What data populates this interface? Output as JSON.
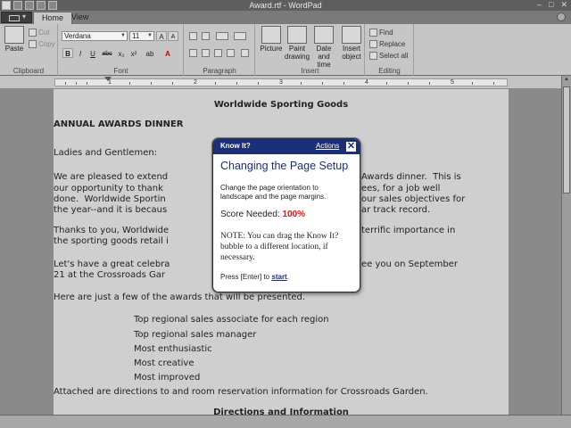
{
  "window": {
    "title": "Award.rtf - WordPad",
    "controls": {
      "minimize": "–",
      "maximize": "□",
      "close": "✕"
    }
  },
  "tabs": [
    {
      "label": "Home"
    },
    {
      "label": "View"
    }
  ],
  "ribbon": {
    "clipboard": {
      "label": "Clipboard",
      "paste": "Paste",
      "cut": "Cut",
      "copy": "Copy"
    },
    "font": {
      "label": "Font",
      "family": "Verdana",
      "size": "11",
      "grow": "A",
      "shrink": "A",
      "bold": "B",
      "italic": "I",
      "underline": "U",
      "strike": "abc",
      "subscript": "x₂",
      "superscript": "x²",
      "highlight": "ab",
      "color": "A"
    },
    "paragraph": {
      "label": "Paragraph"
    },
    "insert": {
      "label": "Insert",
      "picture": "Picture",
      "paint": "Paint drawing",
      "datetime": "Date and time",
      "object": "Insert object"
    },
    "editing": {
      "label": "Editing",
      "find": "Find",
      "replace": "Replace",
      "select_all": "Select all"
    }
  },
  "ruler": {
    "numbers": [
      "1",
      "2",
      "3",
      "4",
      "5"
    ]
  },
  "document": {
    "company": "Worldwide Sporting Goods",
    "heading": "ANNUAL AWARDS DINNER",
    "greeting": "Ladies and Gentlemen:",
    "para1": [
      "We are pleased to extend",
      "our opportunity to thank",
      "done.  Worldwide Sportin",
      "the year--and it is becaus"
    ],
    "para1_right": [
      "Awards dinner.  This is",
      "ees, for a job well",
      "our sales objectives for",
      "ar track record."
    ],
    "para2": [
      "Thanks to you, Worldwide",
      "the sporting goods retail i"
    ],
    "para2_right": [
      "terrific importance in"
    ],
    "para3": [
      "Let's have a great celebra",
      "21 at the Crossroads Gar"
    ],
    "para3_right": [
      "ee you on September"
    ],
    "awards_intro": "Here are just a few of the awards that will be presented.",
    "awards": [
      "Top regional sales associate for each region",
      "Top regional sales manager",
      "Most enthusiastic",
      "Most creative",
      "Most improved"
    ],
    "attached": "Attached are directions to and room reservation information for Crossroads Garden.",
    "section2": "Directions and Information"
  },
  "bubble": {
    "title": "Know It?",
    "actions": "Actions",
    "close": "✕",
    "heading": "Changing the Page Setup",
    "description_line1": "Change the page orientation to",
    "description_line2": "landscape and the page margins.",
    "score_label": "Score Needed:",
    "score_value": "100%",
    "note": "NOTE: You can drag the Know It? bubble to a different location, if necessary.",
    "press_prefix": "Press [Enter] to",
    "start_link": "start",
    "press_suffix": "."
  }
}
